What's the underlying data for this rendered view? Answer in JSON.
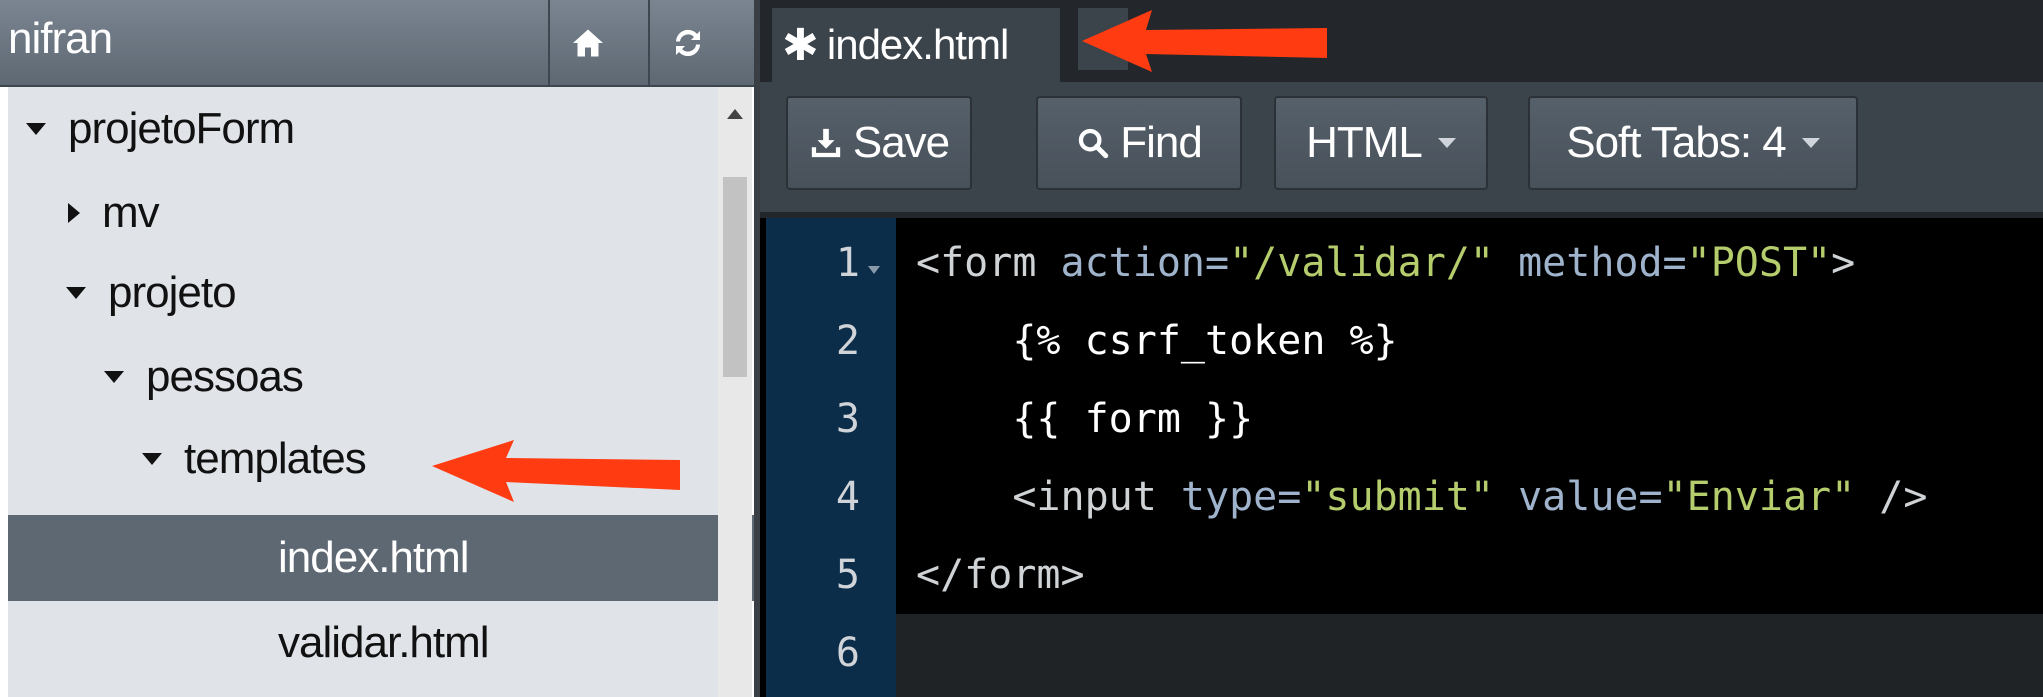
{
  "file_browser": {
    "title": "nifran",
    "home_button": "home-icon",
    "refresh_button": "refresh-icon",
    "tree": [
      {
        "label": "projetoForm",
        "expanded": true,
        "depth": 0
      },
      {
        "label": "mv",
        "expanded": false,
        "depth": 1
      },
      {
        "label": "projeto",
        "expanded": true,
        "depth": 1
      },
      {
        "label": "pessoas",
        "expanded": true,
        "depth": 2
      },
      {
        "label": "templates",
        "expanded": true,
        "depth": 3
      },
      {
        "label": "index.html",
        "selected": true,
        "depth": 4
      },
      {
        "label": "validar.html",
        "depth": 4
      }
    ]
  },
  "editor": {
    "tab": {
      "modified_marker": "✱",
      "label": "index.html"
    },
    "toolbar": {
      "save_label": "Save",
      "find_label": "Find",
      "mode_label": "HTML",
      "tabs_label": "Soft Tabs: 4"
    },
    "line_numbers": [
      "1",
      "2",
      "3",
      "4",
      "5",
      "6"
    ],
    "code": {
      "l1": {
        "open": "<form ",
        "a1": "action=",
        "v1": "\"/validar/\"",
        "a2": " method=",
        "v2": "\"POST\"",
        "close": ">"
      },
      "l2": "    {% csrf_token %}",
      "l3": "    {{ form }}",
      "l4": {
        "open": "    <input ",
        "a1": "type=",
        "v1": "\"submit\"",
        "a2": " value=",
        "v2": "\"Enviar\"",
        "close": " />"
      },
      "l5": "</form>"
    }
  },
  "colors": {
    "arrow": "#ff3b12",
    "gutter": "#0b2d4a",
    "selected_row": "#5e6873"
  }
}
